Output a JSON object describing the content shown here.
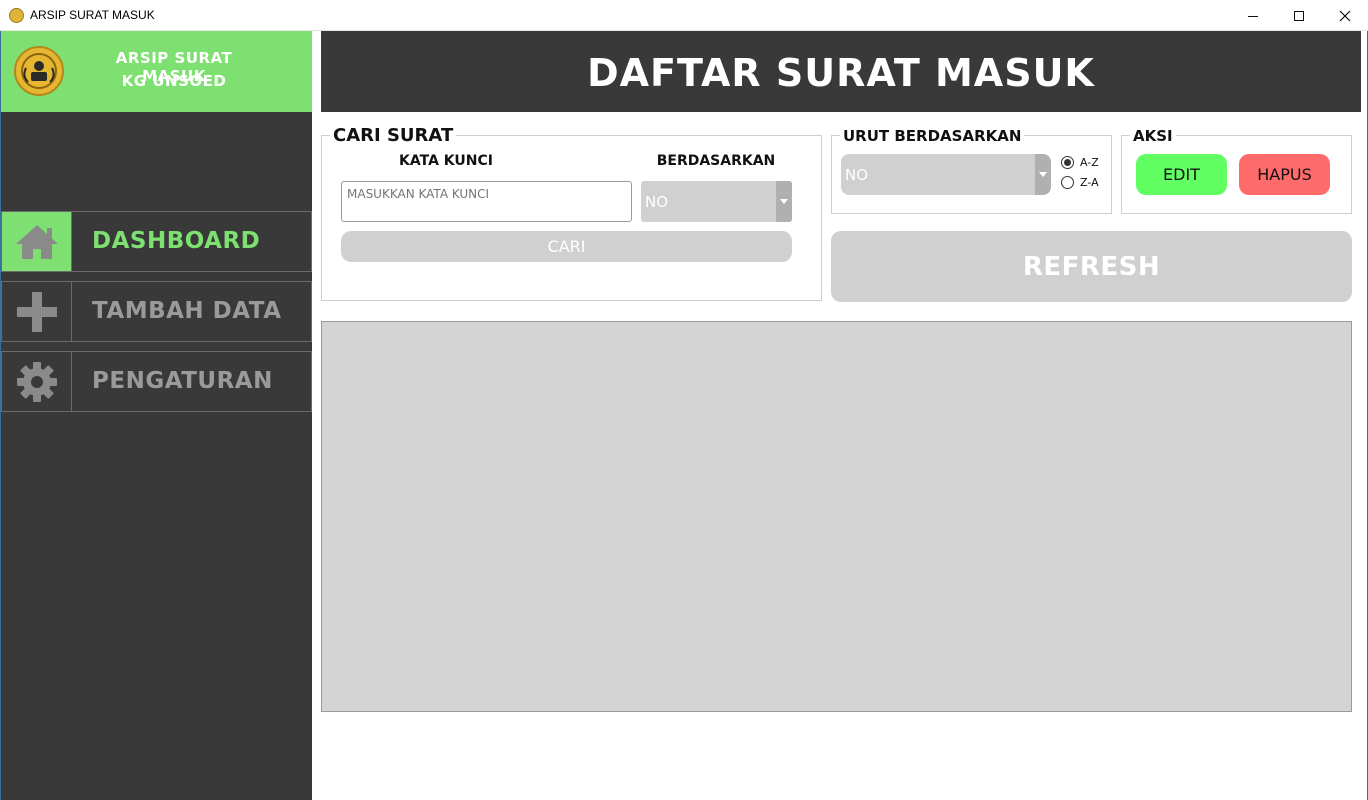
{
  "window": {
    "title": "ARSIP SURAT MASUK"
  },
  "brand": {
    "line1": "ARSIP SURAT MASUK",
    "line2": "KG UNSOED"
  },
  "nav": [
    {
      "label": "DASHBOARD",
      "icon": "home-icon",
      "active": true
    },
    {
      "label": "TAMBAH DATA",
      "icon": "plus-icon",
      "active": false
    },
    {
      "label": "PENGATURAN",
      "icon": "gear-icon",
      "active": false
    }
  ],
  "header": {
    "title": "DAFTAR SURAT MASUK"
  },
  "search": {
    "legend": "CARI SURAT",
    "keyword_label": "KATA KUNCI",
    "keyword_placeholder": "MASUKKAN KATA KUNCI",
    "field_label": "BERDASARKAN",
    "field_value": "NO",
    "button_label": "CARI"
  },
  "sort": {
    "legend": "URUT BERDASARKAN",
    "value": "NO",
    "asc_label": "A-Z",
    "desc_label": "Z-A",
    "selected": "A-Z"
  },
  "actions": {
    "legend": "AKSI",
    "edit_label": "EDIT",
    "delete_label": "HAPUS"
  },
  "refresh": {
    "label": "REFRESH"
  },
  "colors": {
    "accent": "#7de070",
    "dark": "#393939",
    "edit": "#62ff62",
    "delete": "#ff6b6b",
    "disabled": "#d0d0d0"
  }
}
